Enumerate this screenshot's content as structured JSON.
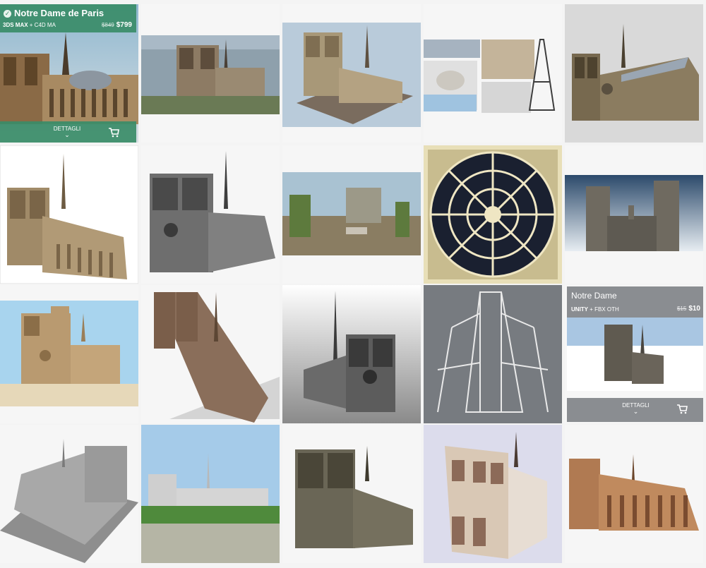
{
  "cards": [
    {
      "title": "Notre Dame de Paris",
      "formats_bold": "3DS MAX",
      "formats_rest": " + C4D MA",
      "price_old": "$849",
      "price": "$799",
      "details_label": "DETTAGLI",
      "accent": "#3a8c68"
    },
    {
      "title": "Notre Dame",
      "formats_bold": "UNITY",
      "formats_rest": " + FBX OTH",
      "price_old": "$15",
      "price": "$10",
      "details_label": "DETTAGLI",
      "accent": "#8a8d91"
    }
  ],
  "icons": {
    "check": "check-icon",
    "cart": "cart-icon",
    "chevron": "chevron-down-icon"
  }
}
